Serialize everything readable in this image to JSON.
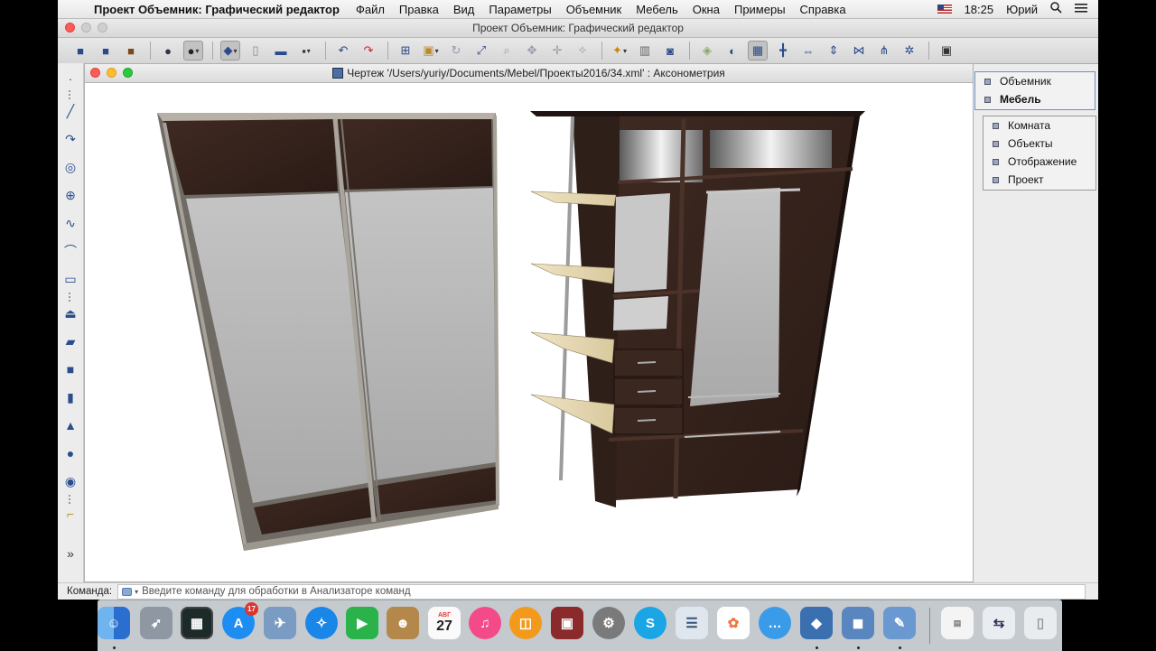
{
  "menubar": {
    "app_name": "Проект Объемник: Графический редактор",
    "items": [
      "Файл",
      "Правка",
      "Вид",
      "Параметры",
      "Объемник",
      "Мебель",
      "Окна",
      "Примеры",
      "Справка"
    ],
    "time": "18:25",
    "user": "Юрий"
  },
  "window": {
    "title": "Проект Объемник: Графический редактор"
  },
  "drawing": {
    "title": "Чертеж '/Users/yuriy/Documents/Mebel/Проекты2016/34.xml' : Аксонометрия"
  },
  "panel_top": {
    "items": [
      "Объемник",
      "Мебель"
    ]
  },
  "panel_bottom": {
    "items": [
      "Комната",
      "Объекты",
      "Отображение",
      "Проект"
    ]
  },
  "command": {
    "label": "Команда:",
    "placeholder": "Введите команду для обработки в Анализаторе команд"
  },
  "dock": {
    "appstore_badge": "17",
    "calendar_day": "27",
    "calendar_month": "АВГ"
  },
  "colors": {
    "wood_dark": "#3a2620",
    "mirror": "#b9b9b9",
    "shelf_light": "#e8dcb8",
    "frame_metal": "#8e8a83"
  }
}
